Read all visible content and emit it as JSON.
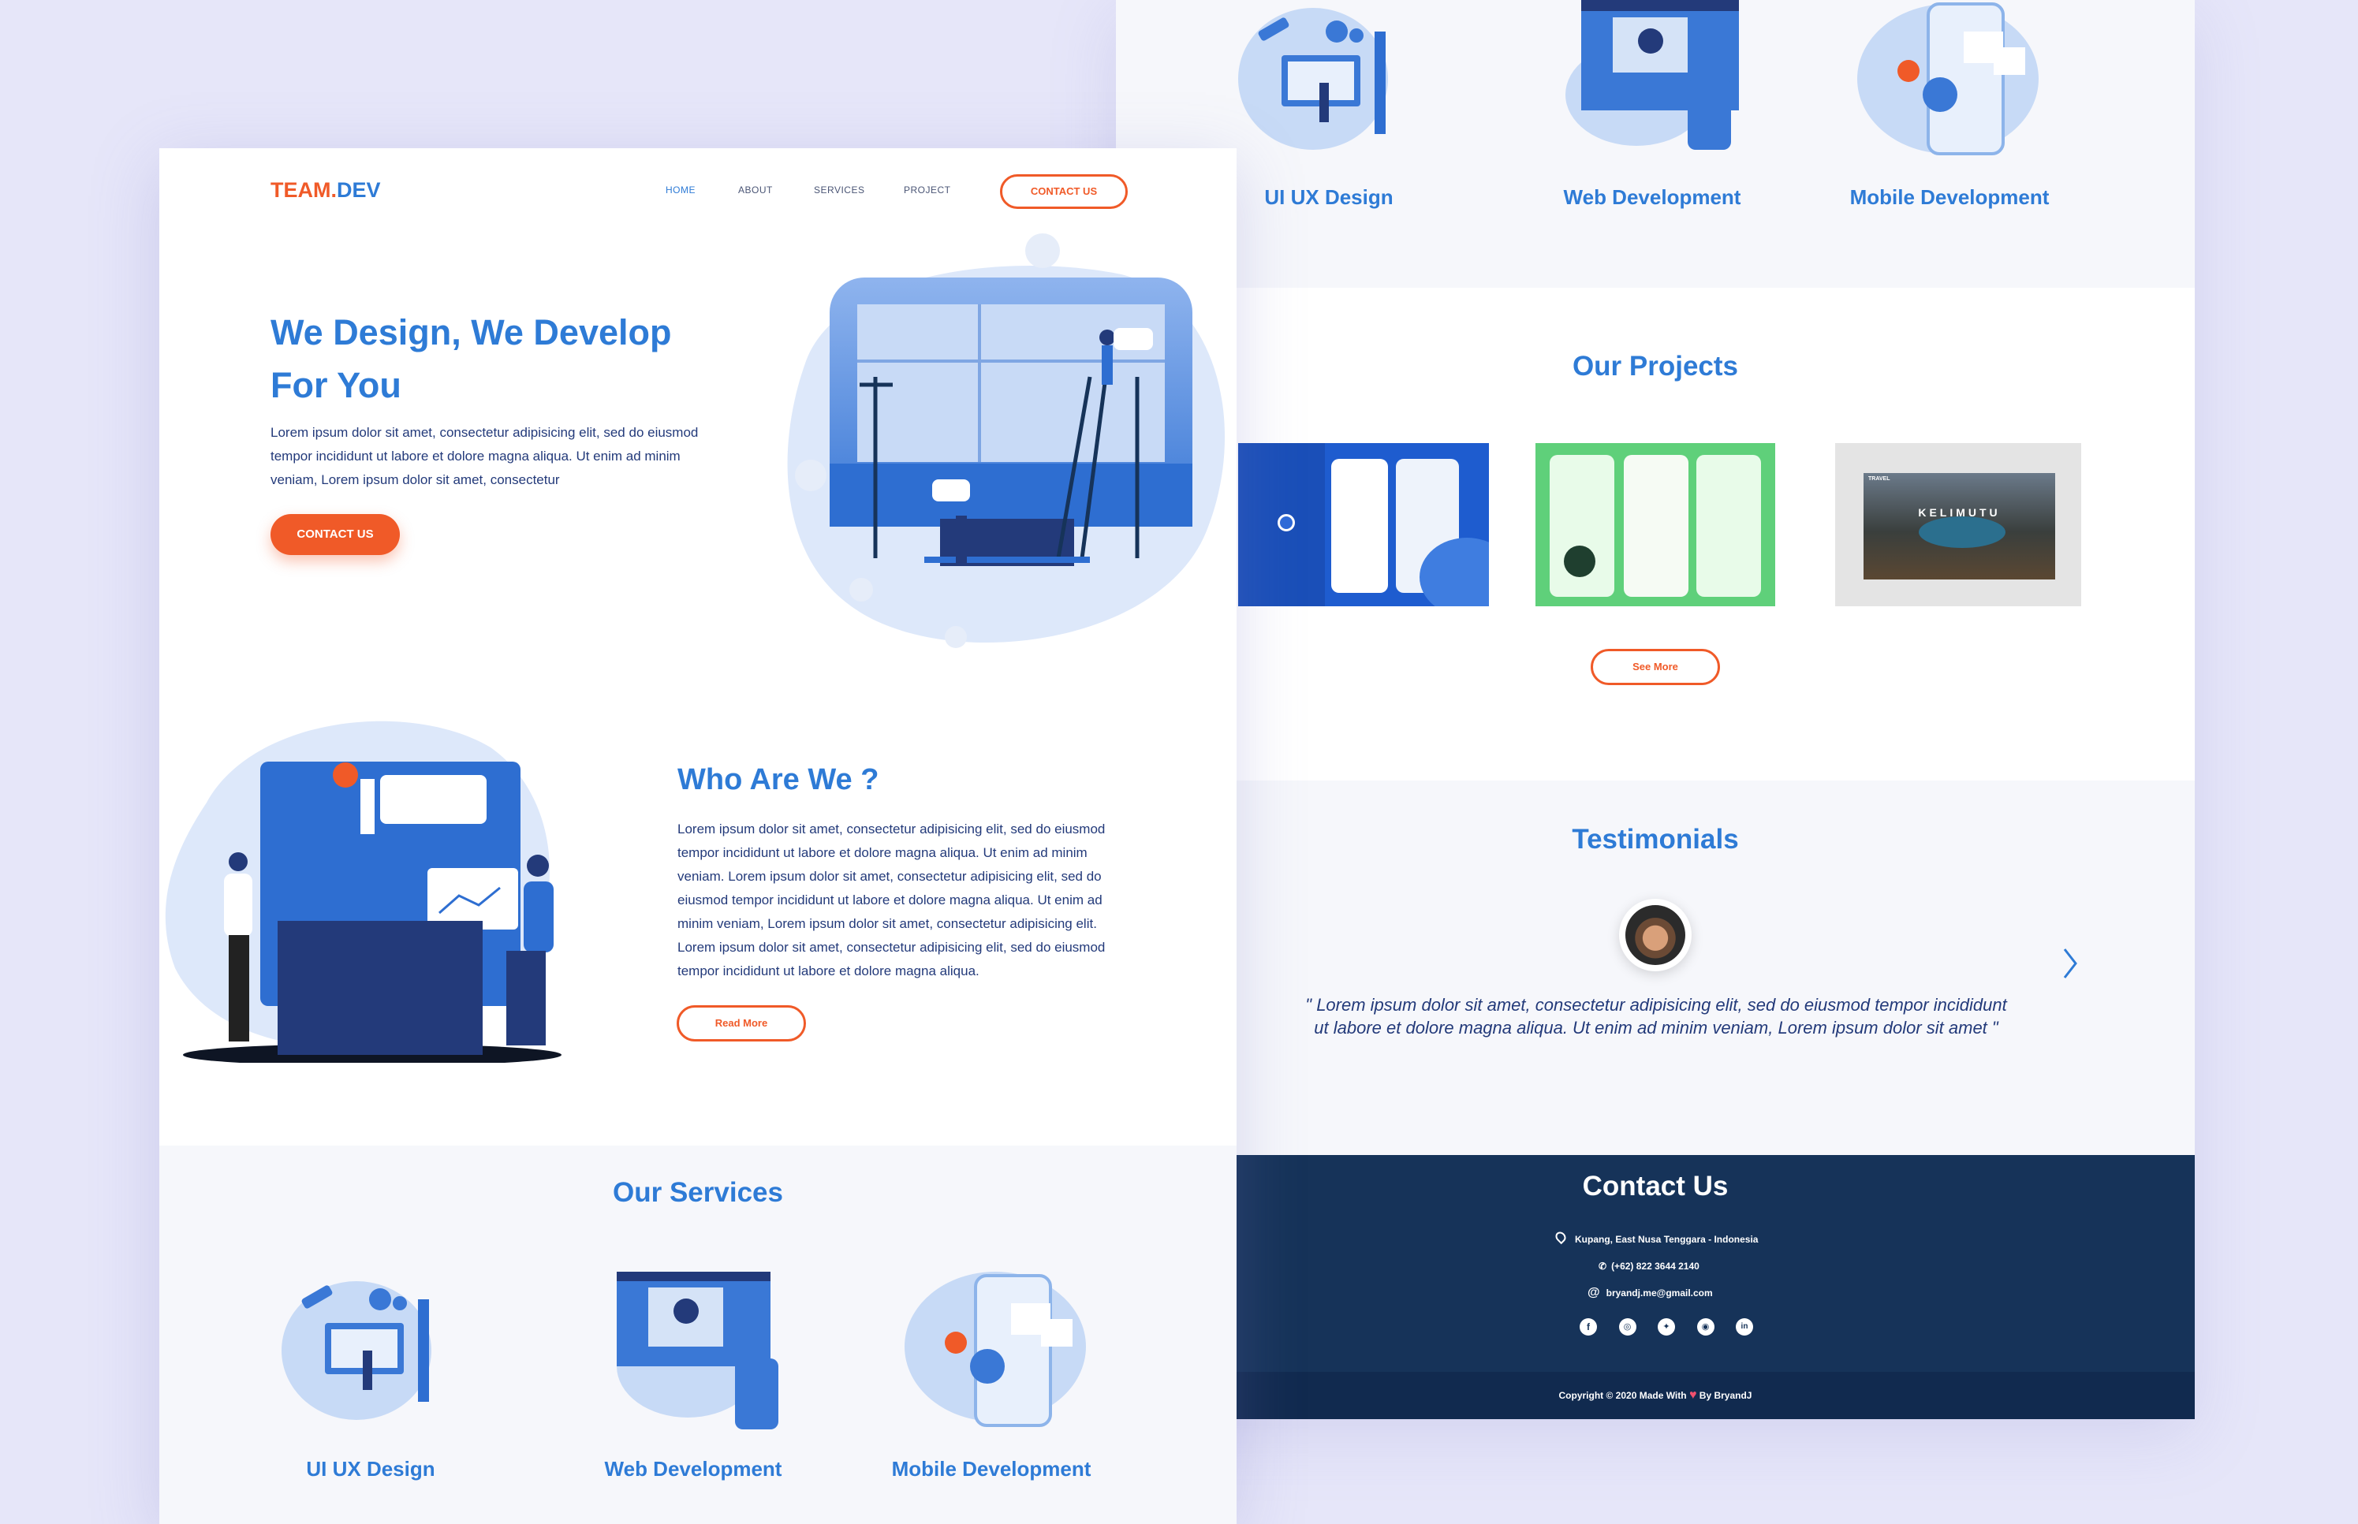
{
  "brand": {
    "part1": "TEAM.",
    "part2": "DEV"
  },
  "nav": {
    "items": [
      "HOME",
      "ABOUT",
      "SERVICES",
      "PROJECT"
    ],
    "contact": "CONTACT US"
  },
  "hero": {
    "title_line1": "We Design, We Develop",
    "title_line2": "For You",
    "text": "Lorem ipsum dolor sit amet, consectetur adipisicing elit, sed do eiusmod tempor incididunt ut labore et dolore magna aliqua. Ut enim ad minim veniam, Lorem ipsum dolor sit amet, consectetur",
    "button": "CONTACT US"
  },
  "about": {
    "title": "Who Are We ?",
    "text": "Lorem ipsum dolor sit amet, consectetur adipisicing elit, sed do eiusmod tempor incididunt ut labore et dolore magna aliqua. Ut enim ad minim veniam. Lorem ipsum dolor sit amet, consectetur adipisicing elit, sed do eiusmod tempor incididunt ut labore et dolore magna aliqua. Ut enim ad minim veniam, Lorem ipsum dolor sit amet, consectetur adipisicing elit. Lorem ipsum dolor sit amet, consectetur adipisicing elit, sed do eiusmod tempor incididunt ut labore et dolore magna aliqua.",
    "button": "Read More"
  },
  "services": {
    "title": "Our Services",
    "items": [
      "UI UX Design",
      "Web Development",
      "Mobile Development"
    ]
  },
  "projects": {
    "title": "Our Projects",
    "button": "See More",
    "kelimutu": "KELIMUTU",
    "travel": "TRAVEL"
  },
  "testimonials": {
    "title": "Testimonials",
    "quote": "\" Lorem ipsum dolor sit amet, consectetur adipisicing elit, sed do eiusmod tempor incididunt ut labore et dolore magna aliqua. Ut enim ad minim veniam, Lorem ipsum dolor sit amet \""
  },
  "contact": {
    "title": "Contact Us",
    "address": "Kupang, East Nusa Tenggara - Indonesia",
    "phone": "(+62) 822 3644 2140",
    "email": "bryandj.me@gmail.com"
  },
  "footer": {
    "copy_before": "Copyright © 2020 Made With",
    "copy_after": "By BryandJ"
  },
  "colors": {
    "primary": "#2e7bd6",
    "accent": "#f05a28",
    "navy": "#163359",
    "footer": "#112a4f"
  },
  "icons": [
    "location-icon",
    "phone-icon",
    "at-icon",
    "facebook-icon",
    "instagram-icon",
    "twitter-icon",
    "whatsapp-icon",
    "linkedin-icon",
    "heart-icon",
    "chevron-left-icon",
    "chevron-right-icon"
  ]
}
